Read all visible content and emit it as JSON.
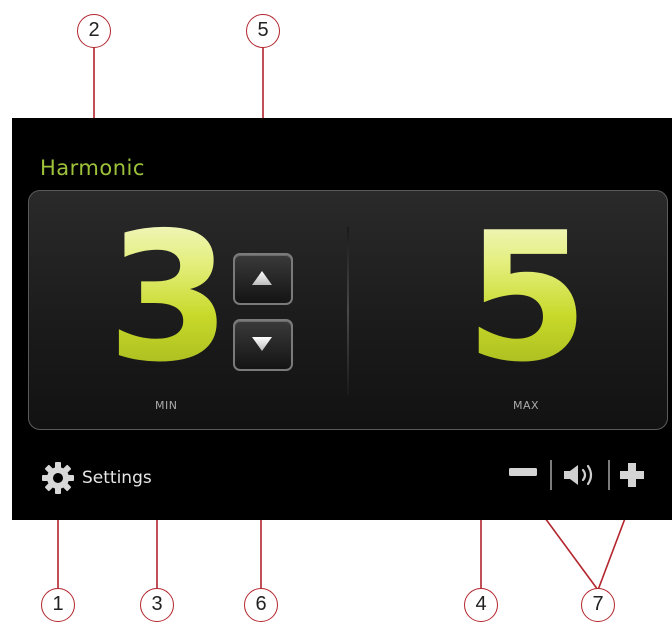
{
  "mode_title": "Harmonic",
  "min": {
    "value": "3",
    "caption": "MIN"
  },
  "max": {
    "value": "5",
    "caption": "MAX"
  },
  "controls": {
    "up_icon": "triangle-up-icon",
    "down_icon": "triangle-down-icon",
    "settings_label": "Settings",
    "settings_icon": "gear-icon",
    "volume_down_icon": "minus-icon",
    "volume_icon": "speaker-icon",
    "volume_up_icon": "plus-icon"
  },
  "callouts": [
    "1",
    "2",
    "3",
    "4",
    "5",
    "6",
    "7"
  ],
  "colors": {
    "title": "#9dc23a",
    "digit_light": "#f4f7cf",
    "digit_dark": "#9fb31b",
    "callout_line": "#b3252d",
    "screen": "#000000"
  }
}
